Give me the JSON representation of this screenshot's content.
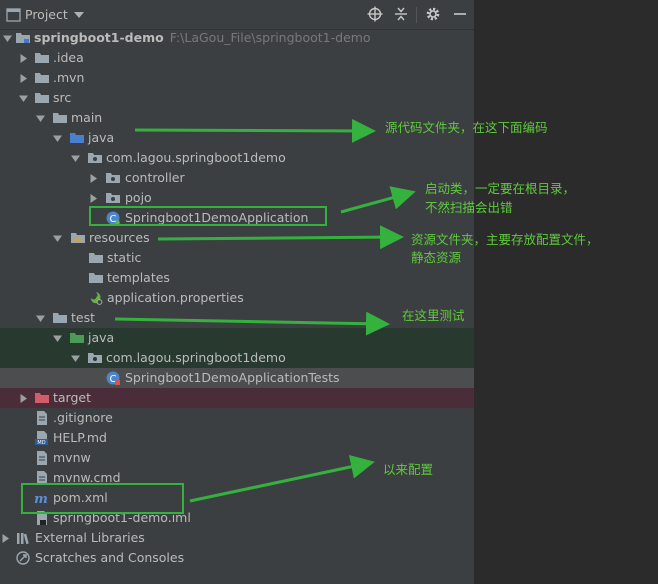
{
  "toolbar": {
    "title": "Project",
    "icons": [
      "dropdown-icon",
      "target-icon",
      "collapse-icon",
      "gear-icon",
      "minimize-icon"
    ]
  },
  "tree": {
    "root": {
      "name": "springboot1-demo",
      "path": "F:\\LaGou_File\\springboot1-demo"
    },
    "idea": ".idea",
    "mvn": ".mvn",
    "src": "src",
    "main": "main",
    "main_java": "java",
    "main_pkg": "com.lagou.springboot1demo",
    "controller": "controller",
    "pojo": "pojo",
    "app_class": "Springboot1DemoApplication",
    "resources": "resources",
    "static": "static",
    "templates": "templates",
    "app_props": "application.properties",
    "test": "test",
    "test_java": "java",
    "test_pkg": "com.lagou.springboot1demo",
    "test_class": "Springboot1DemoApplicationTests",
    "target": "target",
    "gitignore": ".gitignore",
    "help": "HELP.md",
    "mvnw": "mvnw",
    "mvnw_cmd": "mvnw.cmd",
    "pom": "pom.xml",
    "iml": "springboot1-demo.iml",
    "ext_libs": "External Libraries",
    "scratches": "Scratches and Consoles"
  },
  "annotations": {
    "java_source": "源代码文件夹，在这下面编码",
    "app_class_line1": "启动类，一定要在根目录，",
    "app_class_line2": "不然扫描会出错",
    "resources_line1": "资源文件夹，主要存放配置文件，",
    "resources_line2": "静态资源",
    "test": "在这里测试",
    "pom": "以来配置"
  },
  "colors": {
    "annotation": "#5fca3c",
    "panel": "#3c3f41",
    "test_highlight": "#283a2f",
    "target_highlight": "#4a2d38"
  }
}
